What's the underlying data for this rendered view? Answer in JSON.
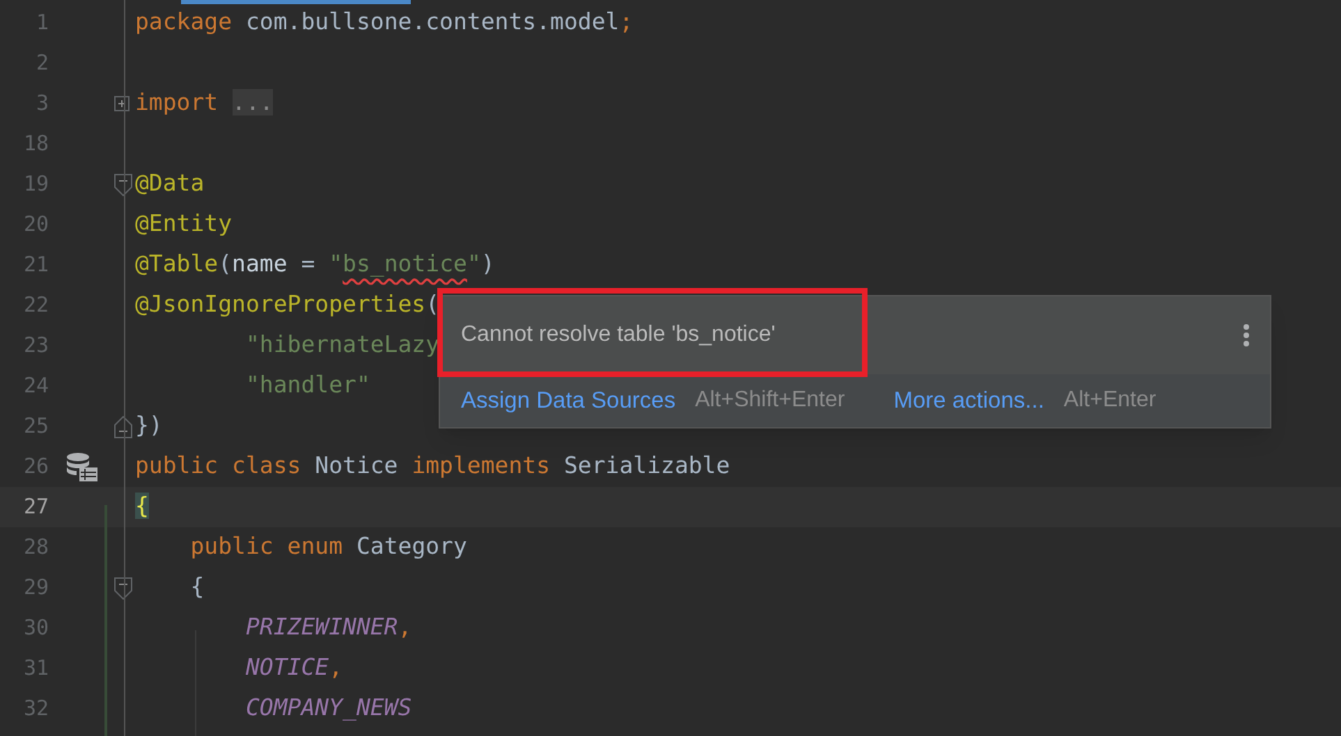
{
  "editor": {
    "lines": [
      {
        "number": "1",
        "current": false,
        "tokens": [
          {
            "kind": "keyword",
            "text": "package "
          },
          {
            "kind": "plain",
            "text": "com.bullsone.contents.model"
          },
          {
            "kind": "keyword",
            "text": ";"
          }
        ]
      },
      {
        "number": "2",
        "current": false
      },
      {
        "number": "3",
        "current": false,
        "fold_marker": {
          "kind": "expand"
        },
        "tokens": [
          {
            "kind": "keyword",
            "text": "import "
          },
          {
            "kind": "folded",
            "text": "..."
          }
        ]
      },
      {
        "number": "18",
        "current": false
      },
      {
        "number": "19",
        "current": false,
        "fold_marker": {
          "kind": "start"
        },
        "tokens": [
          {
            "kind": "annotation",
            "text": "@Data"
          }
        ]
      },
      {
        "number": "20",
        "current": false,
        "tokens": [
          {
            "kind": "annotation",
            "text": "@Entity"
          }
        ]
      },
      {
        "number": "21",
        "current": false,
        "tokens": [
          {
            "kind": "annotation",
            "text": "@Table"
          },
          {
            "kind": "plain",
            "text": "("
          },
          {
            "kind": "param",
            "text": "name"
          },
          {
            "kind": "plain",
            "text": " = "
          },
          {
            "kind": "string",
            "text": "\""
          },
          {
            "kind": "error",
            "text": "bs_notice"
          },
          {
            "kind": "string",
            "text": "\""
          },
          {
            "kind": "plain",
            "text": ")"
          }
        ]
      },
      {
        "number": "22",
        "current": false,
        "tokens": [
          {
            "kind": "annotation",
            "text": "@JsonIgnoreProperties"
          },
          {
            "kind": "plain",
            "text": "("
          }
        ]
      },
      {
        "number": "23",
        "current": false,
        "tokens": [
          {
            "kind": "string",
            "text": "        \"hibernateLazy"
          }
        ]
      },
      {
        "number": "24",
        "current": false,
        "tokens": [
          {
            "kind": "string",
            "text": "        \"handler\""
          }
        ]
      },
      {
        "number": "25",
        "current": false,
        "fold_marker": {
          "kind": "end"
        },
        "tokens": [
          {
            "kind": "plain",
            "text": "})"
          }
        ]
      },
      {
        "number": "26",
        "current": false,
        "gutter_icon": {
          "kind": "database"
        },
        "tokens": [
          {
            "kind": "keyword",
            "text": "public class "
          },
          {
            "kind": "plain",
            "text": "Notice "
          },
          {
            "kind": "keyword",
            "text": "implements "
          },
          {
            "kind": "plain",
            "text": "Serializable"
          }
        ]
      },
      {
        "number": "27",
        "current": true,
        "tokens": [
          {
            "kind": "brace",
            "text": "{"
          }
        ]
      },
      {
        "number": "28",
        "current": false,
        "tokens": [
          {
            "kind": "keyword",
            "text": "    public enum "
          },
          {
            "kind": "plain",
            "text": "Category"
          }
        ]
      },
      {
        "number": "29",
        "current": false,
        "fold_marker": {
          "kind": "start"
        },
        "tokens": [
          {
            "kind": "plain",
            "text": "    {"
          }
        ]
      },
      {
        "number": "30",
        "current": false,
        "tokens": [
          {
            "kind": "constant",
            "text": "        PRIZEWINNER"
          },
          {
            "kind": "keyword",
            "text": ","
          }
        ]
      },
      {
        "number": "31",
        "current": false,
        "tokens": [
          {
            "kind": "constant",
            "text": "        NOTICE"
          },
          {
            "kind": "keyword",
            "text": ","
          }
        ]
      },
      {
        "number": "32",
        "current": false,
        "tokens": [
          {
            "kind": "constant",
            "text": "        COMPANY_NEWS"
          }
        ]
      }
    ]
  },
  "popup": {
    "message": "Cannot resolve table 'bs_notice'",
    "actions": [
      {
        "label": "Assign Data Sources",
        "shortcut": "Alt+Shift+Enter"
      },
      {
        "label": "More actions...",
        "shortcut": "Alt+Enter"
      }
    ]
  }
}
